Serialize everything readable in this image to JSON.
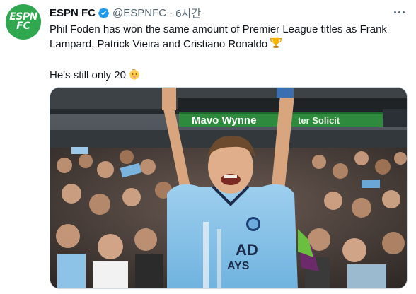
{
  "account": {
    "display_name": "ESPN FC",
    "handle": "@ESPNFC",
    "separator": "·",
    "time": "6시간",
    "avatar_text_line1": "ESPN",
    "avatar_text_line2": "FC",
    "brand_color": "#2fa84f",
    "verified_color": "#1d9bf0"
  },
  "tweet": {
    "line1": "Phil Foden has won the same amount of Premier League titles as Frank",
    "line2": "Lampard, Patrick Vieira and Cristiano Ronaldo",
    "line3": "He's still only 20",
    "emoji1": "trophy-icon",
    "emoji2": "baby-face-icon"
  },
  "media": {
    "stadium_sign_1": "Mavo Wynne",
    "stadium_sign_2": "ter Solicit",
    "shirt_text": "AD",
    "shirt_text_2": "AYS"
  }
}
